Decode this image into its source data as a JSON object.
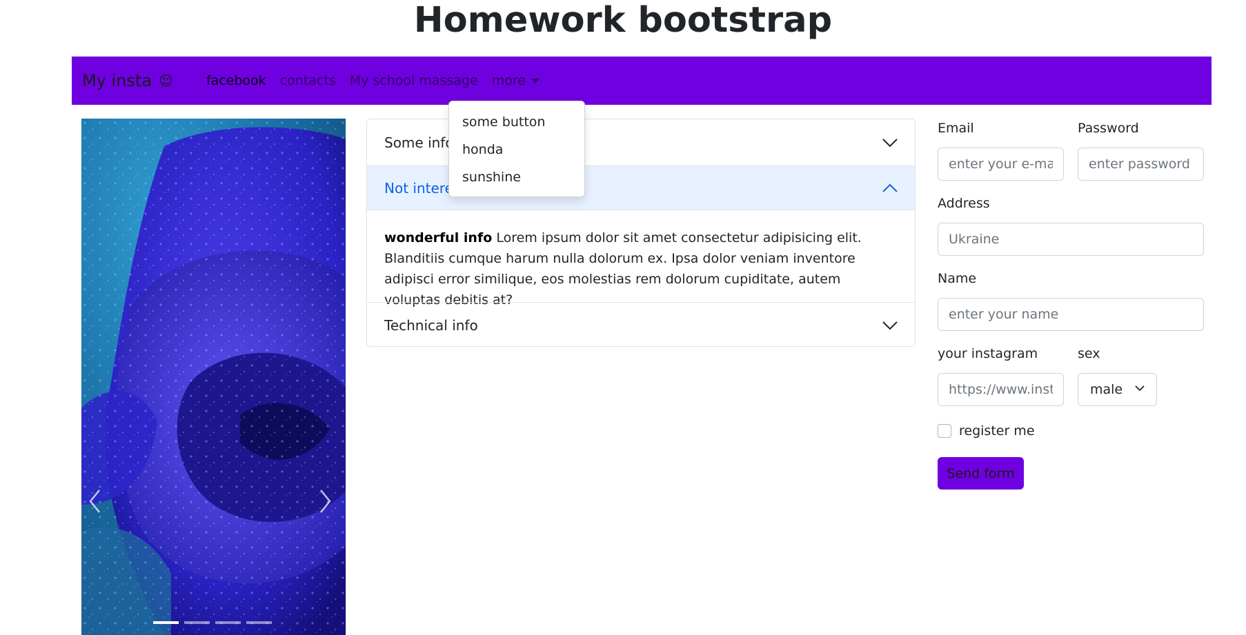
{
  "page": {
    "title": "Homework bootstrap"
  },
  "colors": {
    "brand": "#6f00df",
    "accordion_open_bg": "#e7f1ff",
    "accordion_open_text": "#0c63e4"
  },
  "navbar": {
    "brand": "My insta",
    "brand_icon": "smile-icon",
    "links": [
      {
        "label": "facebook",
        "active": true
      },
      {
        "label": "contacts",
        "active": false
      },
      {
        "label": "My school massage",
        "active": false
      }
    ],
    "dropdown": {
      "label": "more",
      "expanded": true,
      "items": [
        "some button",
        "honda",
        "sunshine"
      ]
    }
  },
  "carousel": {
    "image": "blue rose with water droplets",
    "slide_count": 4,
    "active_slide": 1,
    "prev_icon": "chevron-left-icon",
    "next_icon": "chevron-right-icon"
  },
  "accordion": {
    "items": [
      {
        "title": "Some info",
        "expanded": false
      },
      {
        "title": "Not interesting info",
        "expanded": true,
        "body_bold": "wonderful info",
        "body_text": " Lorem ipsum dolor sit amet consectetur adipisicing elit. Blanditiis cumque harum nulla dolorum ex. Ipsa dolor veniam inventore adipisci error similique, eos molestias rem dolorum cupiditate, autem voluptas debitis at?"
      },
      {
        "title": "Technical info",
        "expanded": false
      }
    ]
  },
  "form": {
    "email": {
      "label": "Email",
      "placeholder": "enter your e-mail"
    },
    "password": {
      "label": "Password",
      "placeholder": "enter password"
    },
    "address": {
      "label": "Address",
      "placeholder": "Ukraine"
    },
    "name": {
      "label": "Name",
      "placeholder": "enter your name"
    },
    "instagram": {
      "label": "your instagram",
      "placeholder": "https://www.instagram.com/"
    },
    "sex": {
      "label": "sex",
      "value": "male"
    },
    "register": {
      "label": "register me",
      "checked": false
    },
    "submit_label": "Send form"
  }
}
